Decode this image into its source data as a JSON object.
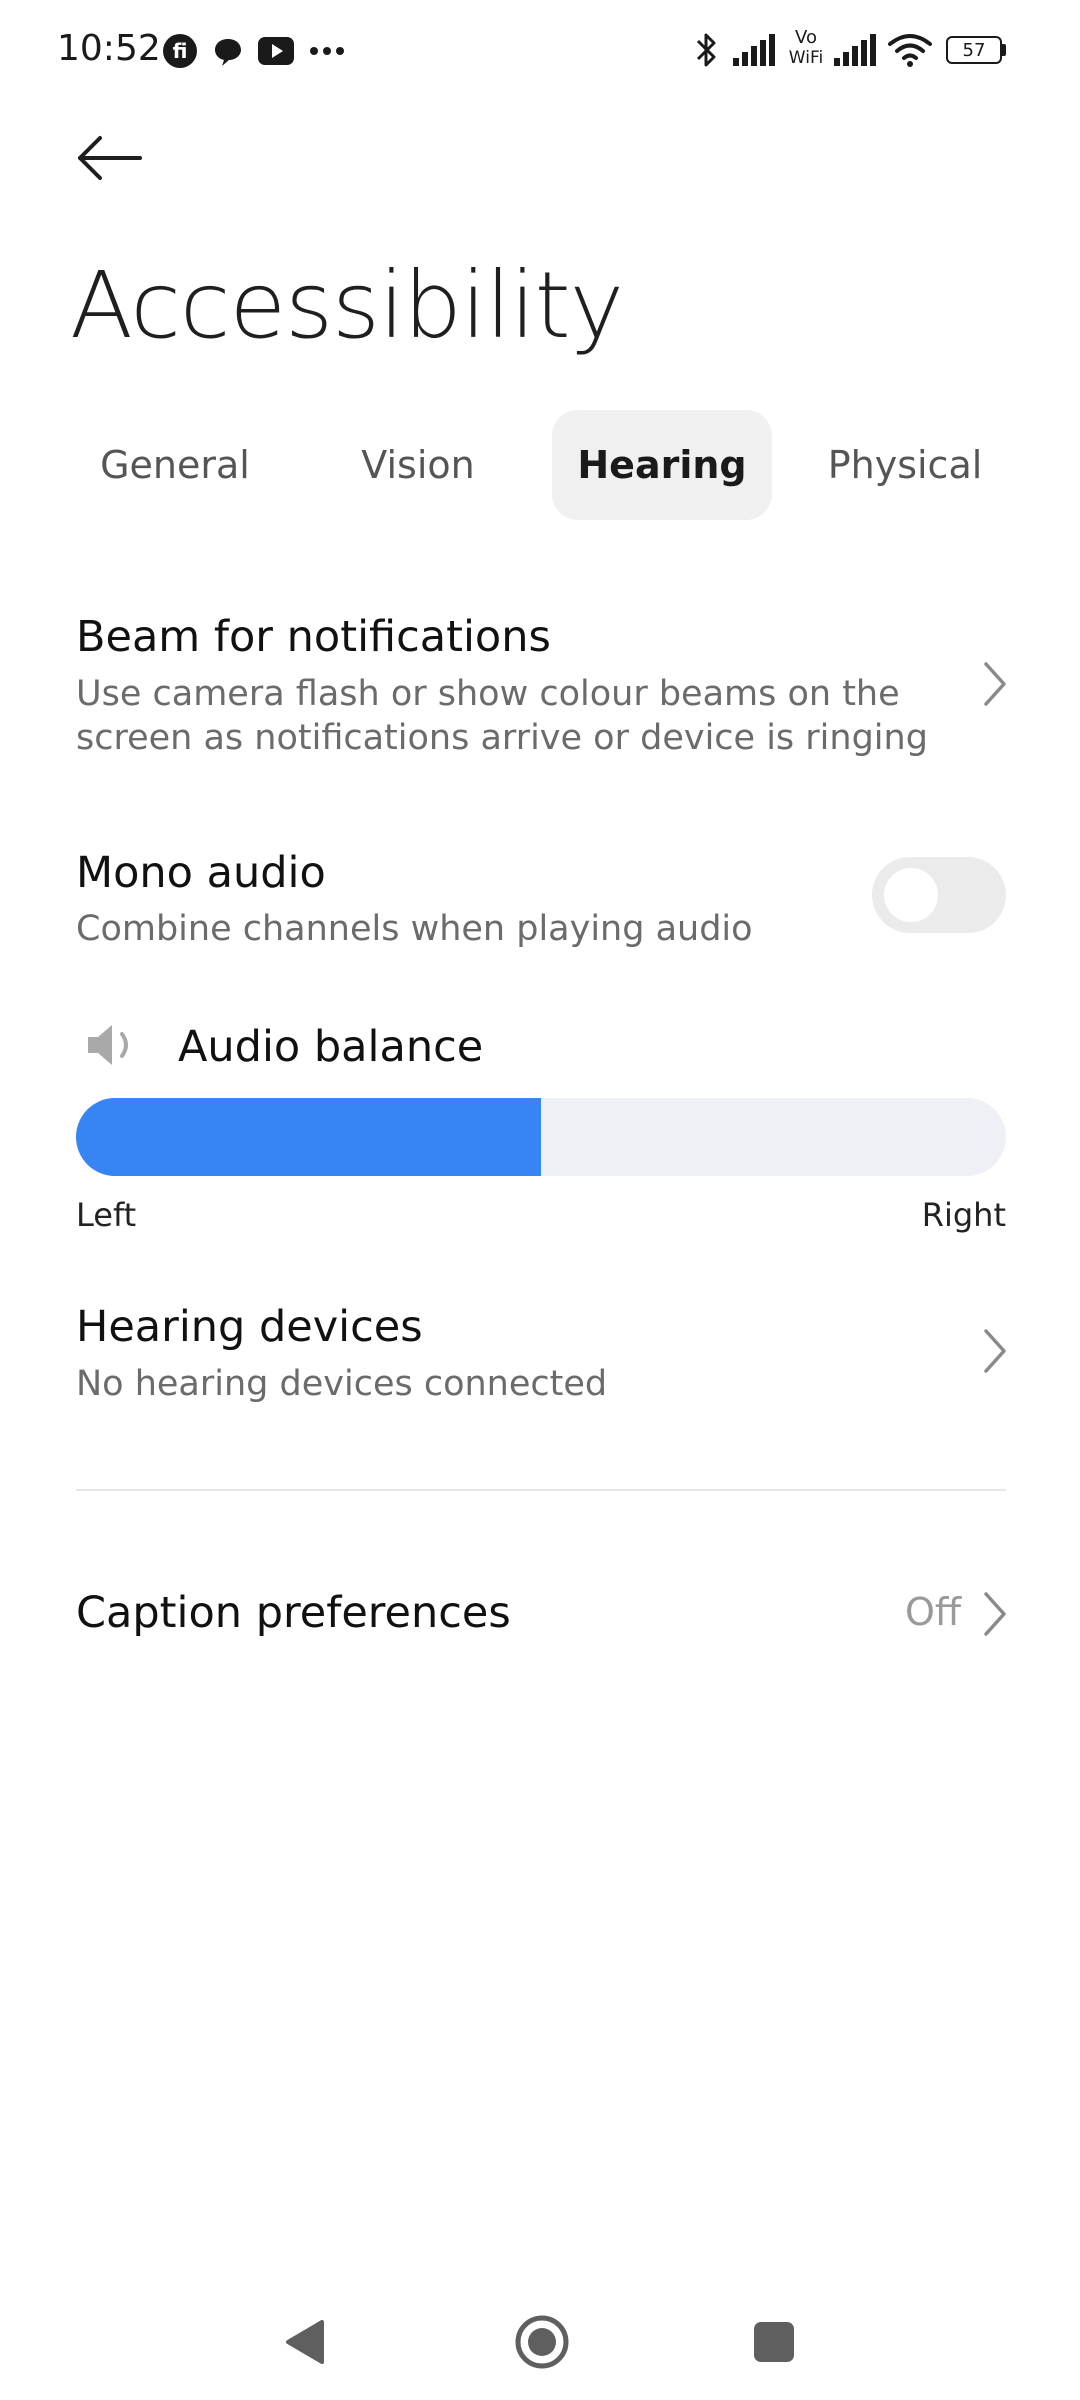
{
  "status_bar": {
    "time": "10:52",
    "notification_icons": [
      "fi-app-icon",
      "chat-bubble-icon",
      "youtube-icon",
      "more-dots-icon"
    ],
    "system_icons": [
      "bluetooth-icon",
      "signal-icon",
      "vowifi-icon",
      "signal-icon",
      "wifi-icon",
      "battery-icon"
    ],
    "vowifi_label_top": "Vo",
    "vowifi_label_bottom": "WiFi",
    "battery_level": "57"
  },
  "header": {
    "title": "Accessibility"
  },
  "tabs": [
    {
      "label": "General",
      "active": false
    },
    {
      "label": "Vision",
      "active": false
    },
    {
      "label": "Hearing",
      "active": true
    },
    {
      "label": "Physical",
      "active": false
    }
  ],
  "settings": {
    "beam": {
      "title": "Beam for notifications",
      "subtitle_line1": "Use camera flash or show colour beams on the",
      "subtitle_line2": "screen as notifications arrive or device is ringing"
    },
    "mono_audio": {
      "title": "Mono audio",
      "subtitle": "Combine channels when playing audio",
      "enabled": false
    },
    "audio_balance": {
      "title": "Audio balance",
      "left_label": "Left",
      "right_label": "Right",
      "value_fraction": 0.5
    },
    "hearing_devices": {
      "title": "Hearing devices",
      "subtitle": "No hearing devices connected"
    },
    "caption_preferences": {
      "title": "Caption preferences",
      "value": "Off"
    }
  },
  "colors": {
    "accent": "#3784f5",
    "track": "#eff0f5",
    "active_tab_bg": "#f0f0f0"
  }
}
